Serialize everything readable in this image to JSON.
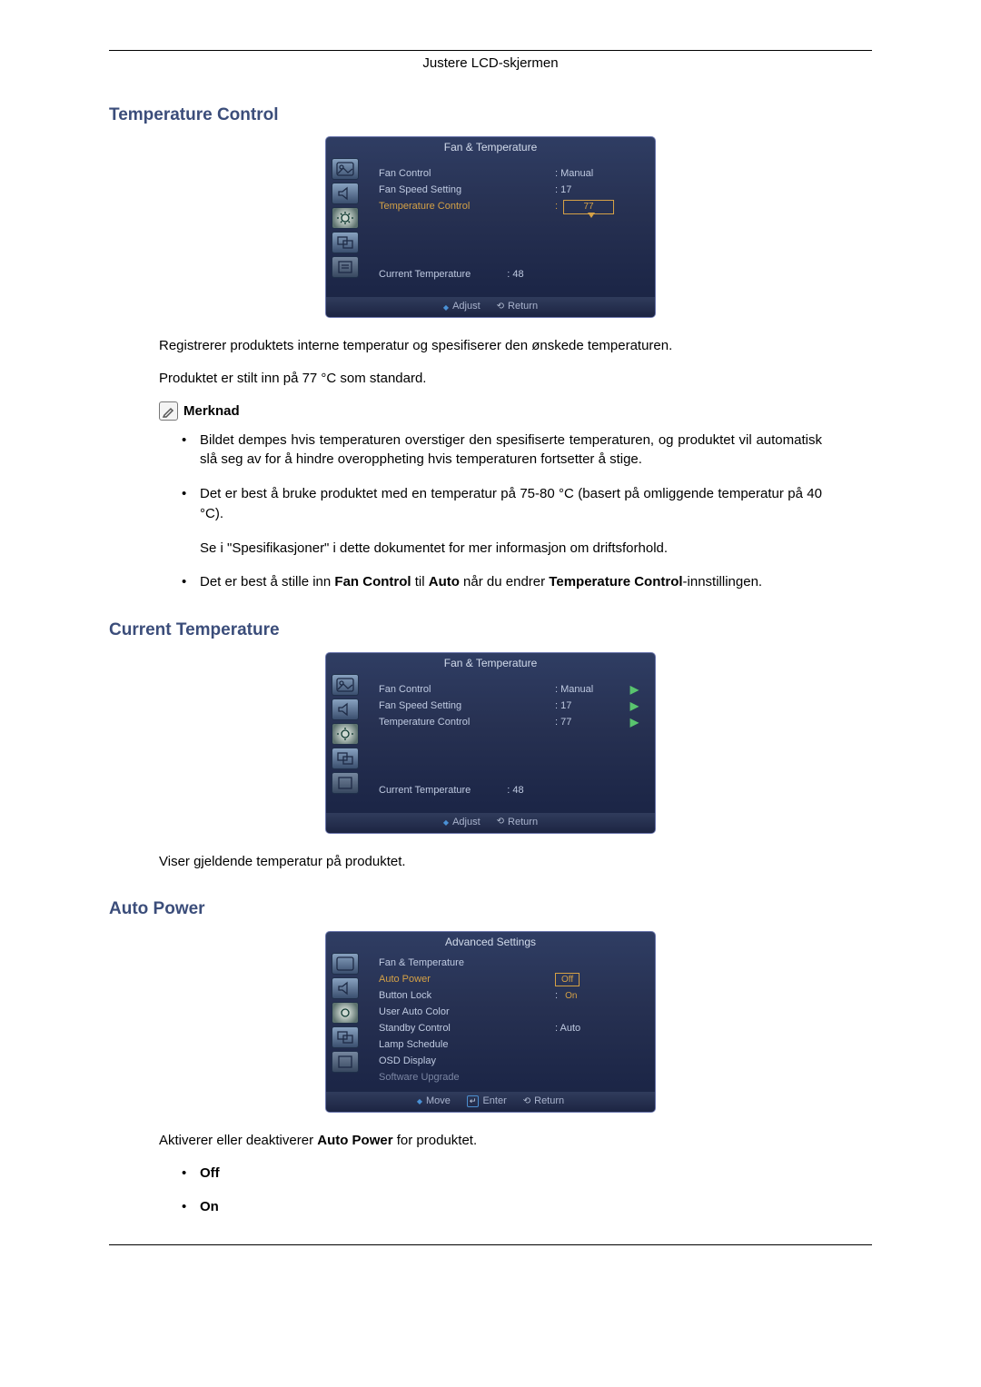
{
  "header": "Justere LCD-skjermen",
  "sections": {
    "temperature_control": {
      "title": "Temperature Control"
    },
    "current_temperature": {
      "title": "Current Temperature"
    },
    "auto_power": {
      "title": "Auto Power"
    }
  },
  "osd1": {
    "title": "Fan & Temperature",
    "rows": {
      "fan_control": {
        "label": "Fan Control",
        "value": ": Manual"
      },
      "fan_speed": {
        "label": "Fan Speed Setting",
        "value": ": 17"
      },
      "temp_control": {
        "label": "Temperature Control",
        "slider_value": "77"
      }
    },
    "current_temp": {
      "label": "Current Temperature",
      "value": ": 48"
    },
    "footer": {
      "adjust": "Adjust",
      "return": "Return"
    }
  },
  "osd2": {
    "title": "Fan & Temperature",
    "rows": {
      "fan_control": {
        "label": "Fan Control",
        "value": ": Manual"
      },
      "fan_speed": {
        "label": "Fan Speed Setting",
        "value": ": 17"
      },
      "temp_control": {
        "label": "Temperature Control",
        "value": ": 77"
      }
    },
    "current_temp": {
      "label": "Current Temperature",
      "value": ": 48"
    },
    "footer": {
      "adjust": "Adjust",
      "return": "Return"
    }
  },
  "osd3": {
    "title": "Advanced Settings",
    "rows": {
      "fan_temp": {
        "label": "Fan & Temperature"
      },
      "auto_power": {
        "label": "Auto Power",
        "opt_off": "Off",
        "opt_on": "On"
      },
      "button_lock": {
        "label": "Button Lock"
      },
      "user_auto_color": {
        "label": "User Auto Color"
      },
      "standby_control": {
        "label": "Standby Control",
        "value": ": Auto"
      },
      "lamp_schedule": {
        "label": "Lamp Schedule"
      },
      "osd_display": {
        "label": "OSD Display"
      },
      "software_upgrade": {
        "label": "Software Upgrade"
      }
    },
    "footer": {
      "move": "Move",
      "enter": "Enter",
      "return": "Return"
    }
  },
  "body": {
    "p1": "Registrerer produktets interne temperatur og spesifiserer den ønskede temperaturen.",
    "p2": "Produktet er stilt inn på 77 °C som standard.",
    "note_label": "Merknad",
    "b1": "Bildet dempes hvis temperaturen overstiger den spesifiserte temperaturen, og produktet vil automatisk slå seg av for å hindre overoppheting hvis temperaturen fortsetter å stige.",
    "b2a": "Det er best å bruke produktet med en temperatur på 75-80 °C (basert på omliggende temperatur på 40 °C).",
    "b2b": "Se i \"Spesifikasjoner\" i dette dokumentet for mer informasjon om driftsforhold.",
    "b3_pre": "Det er best å stille inn ",
    "b3_fc": "Fan Control",
    "b3_mid1": " til ",
    "b3_auto": "Auto",
    "b3_mid2": " når du endrer ",
    "b3_tc": "Temperature Control",
    "b3_post": "-innstillingen.",
    "ct_desc": "Viser gjeldende temperatur på produktet.",
    "ap_pre": "Aktiverer eller deaktiverer ",
    "ap_bold": "Auto Power",
    "ap_post": " for produktet.",
    "off": "Off",
    "on": "On"
  }
}
